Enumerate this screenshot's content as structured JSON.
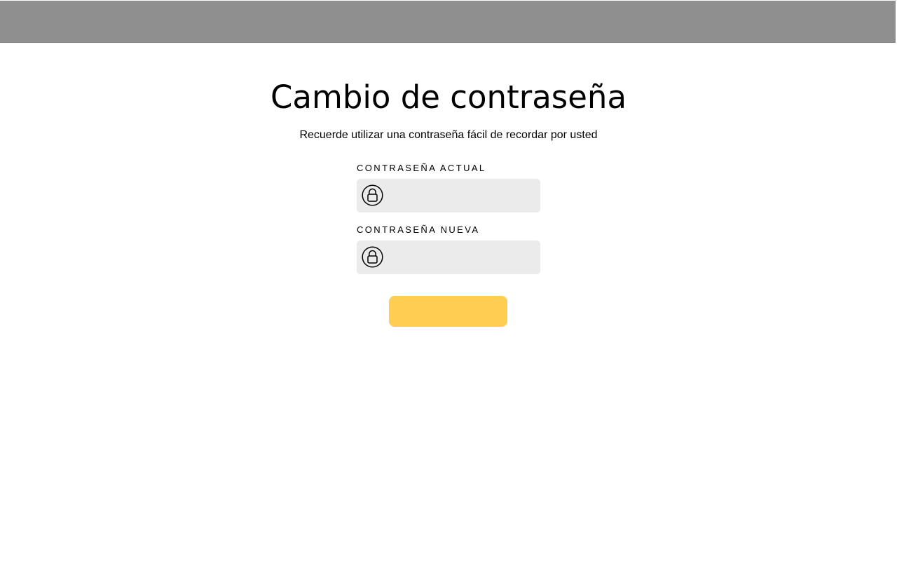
{
  "page": {
    "title": "Cambio de contraseña",
    "subtitle": "Recuerde utilizar una contraseña fácil de recordar por usted"
  },
  "form": {
    "current_password": {
      "label": "CONTRASEÑA ACTUAL",
      "value": "",
      "icon": "lock-icon"
    },
    "new_password": {
      "label": "CONTRASEÑA NUEVA",
      "value": "",
      "icon": "lock-icon"
    },
    "submit_label": ""
  },
  "colors": {
    "top_bar": "#8f8f8f",
    "field_background": "#ebebeb",
    "button_background": "#ffcd52"
  }
}
